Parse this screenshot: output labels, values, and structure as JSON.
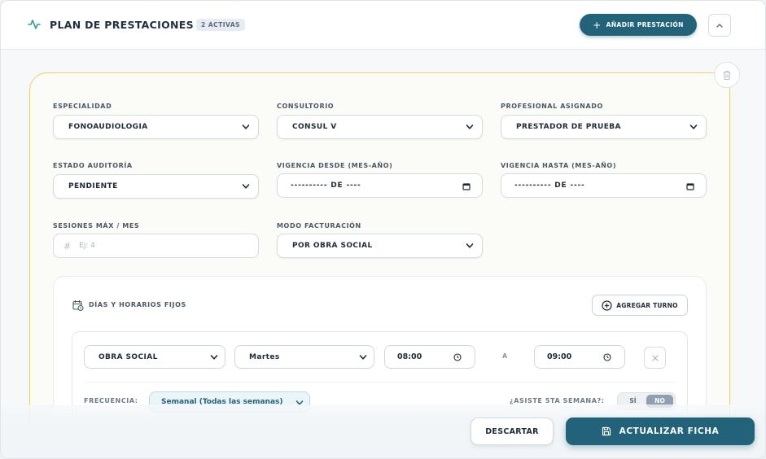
{
  "header": {
    "title": "PLAN DE PRESTACIONES",
    "badge": "2 ACTIVAS",
    "add_button": "AÑADIR PRESTACIÓN"
  },
  "form": {
    "especialidad": {
      "label": "ESPECIALIDAD",
      "value": "FONOAUDIOLOGIA"
    },
    "consultorio": {
      "label": "CONSULTORIO",
      "value": "CONSUL V"
    },
    "profesional": {
      "label": "PROFESIONAL ASIGNADO",
      "value": "PRESTADOR DE PRUEBA"
    },
    "estado": {
      "label": "ESTADO AUDITORÍA",
      "value": "PENDIENTE"
    },
    "vigencia_desde": {
      "label": "VIGENCIA DESDE (MES-AÑO)",
      "value": "---------- DE ----"
    },
    "vigencia_hasta": {
      "label": "VIGENCIA HASTA (MES-AÑO)",
      "value": "---------- DE ----"
    },
    "sesiones": {
      "label": "SESIONES MÁX / MES",
      "placeholder": "Ej: 4",
      "value": ""
    },
    "modo_facturacion": {
      "label": "MODO FACTURACIÓN",
      "value": "POR OBRA SOCIAL"
    }
  },
  "schedule": {
    "title": "DÍAS Y HORARIOS FIJOS",
    "add_button": "AGREGAR TURNO",
    "row": {
      "tipo": "OBRA SOCIAL",
      "dia": "Martes",
      "desde": "08:00",
      "separator": "A",
      "hasta": "09:00",
      "frecuencia_label": "FRECUENCIA:",
      "frecuencia": "Semanal (Todas las semanas)",
      "quinta_label": "¿ASISTE 5TA SEMANA?:",
      "toggle_yes": "SÍ",
      "toggle_no": "NO",
      "toggle_selected": "NO"
    }
  },
  "footer": {
    "discard": "DESCARTAR",
    "update": "ACTUALIZAR FICHA"
  },
  "colors": {
    "primary": "#23637a",
    "panel_border": "#eccf5a",
    "activity_icon": "#2a9d8f"
  },
  "icons": [
    "activity-icon",
    "plus-icon",
    "chevron-up-icon",
    "trash-icon",
    "chevron-down-icon",
    "calendar-icon",
    "hash-icon",
    "calendar-clock-icon",
    "plus-circle-icon",
    "clock-icon",
    "close-icon",
    "save-icon"
  ]
}
